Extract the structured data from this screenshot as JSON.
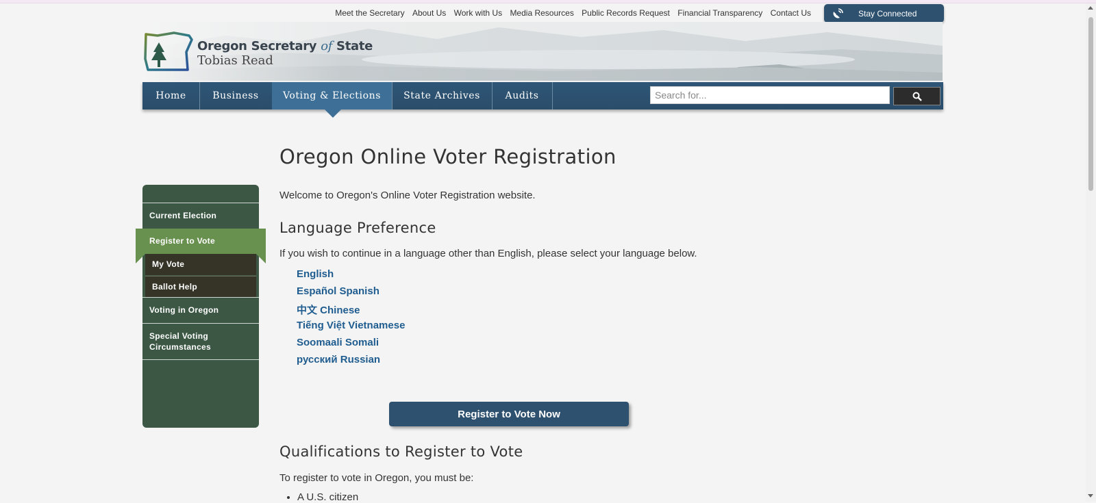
{
  "utility_nav": [
    "Meet the Secretary",
    "About Us",
    "Work with Us",
    "Media Resources",
    "Public Records Request",
    "Financial Transparency",
    "Contact Us"
  ],
  "stay_connected": {
    "label": "Stay Connected",
    "icon": "satellite-dish-icon"
  },
  "brand": {
    "title_part1": "Oregon Secretary ",
    "title_italic": "of",
    "title_part2": " State",
    "name": "Tobias Read"
  },
  "main_nav": {
    "items": [
      "Home",
      "Business",
      "Voting & Elections",
      "State Archives",
      "Audits"
    ],
    "active": "Voting & Elections"
  },
  "search": {
    "placeholder": "Search for...",
    "icon": "search-icon"
  },
  "sidebar": {
    "items": [
      "Current Election",
      "Register to Vote",
      "Voting in Oregon",
      "Special Voting Circumstances"
    ],
    "active": "Register to Vote",
    "subitems": [
      "My Vote",
      "Ballot Help"
    ]
  },
  "content": {
    "title": "Oregon Online Voter Registration",
    "welcome": "Welcome to Oregon's Online Voter Registration website.",
    "language_heading": "Language Preference",
    "language_intro": "If you wish to continue in a language other than English, please select your language below.",
    "languages": [
      "English",
      "Español Spanish",
      "中文 Chinese",
      "Tiếng Việt Vietnamese",
      "Soomaali Somali",
      "русский Russian"
    ],
    "cta_label": "Register to Vote Now",
    "qual_heading": "Qualifications to Register to Vote",
    "qual_intro": "To register to vote in Oregon, you must be:",
    "qual_items": [
      "A U.S. citizen"
    ]
  },
  "colors": {
    "nav_blue": "#2f5677",
    "sidebar_green": "#3c5845",
    "active_green": "#68904f",
    "link_blue": "#1f5c8f"
  }
}
